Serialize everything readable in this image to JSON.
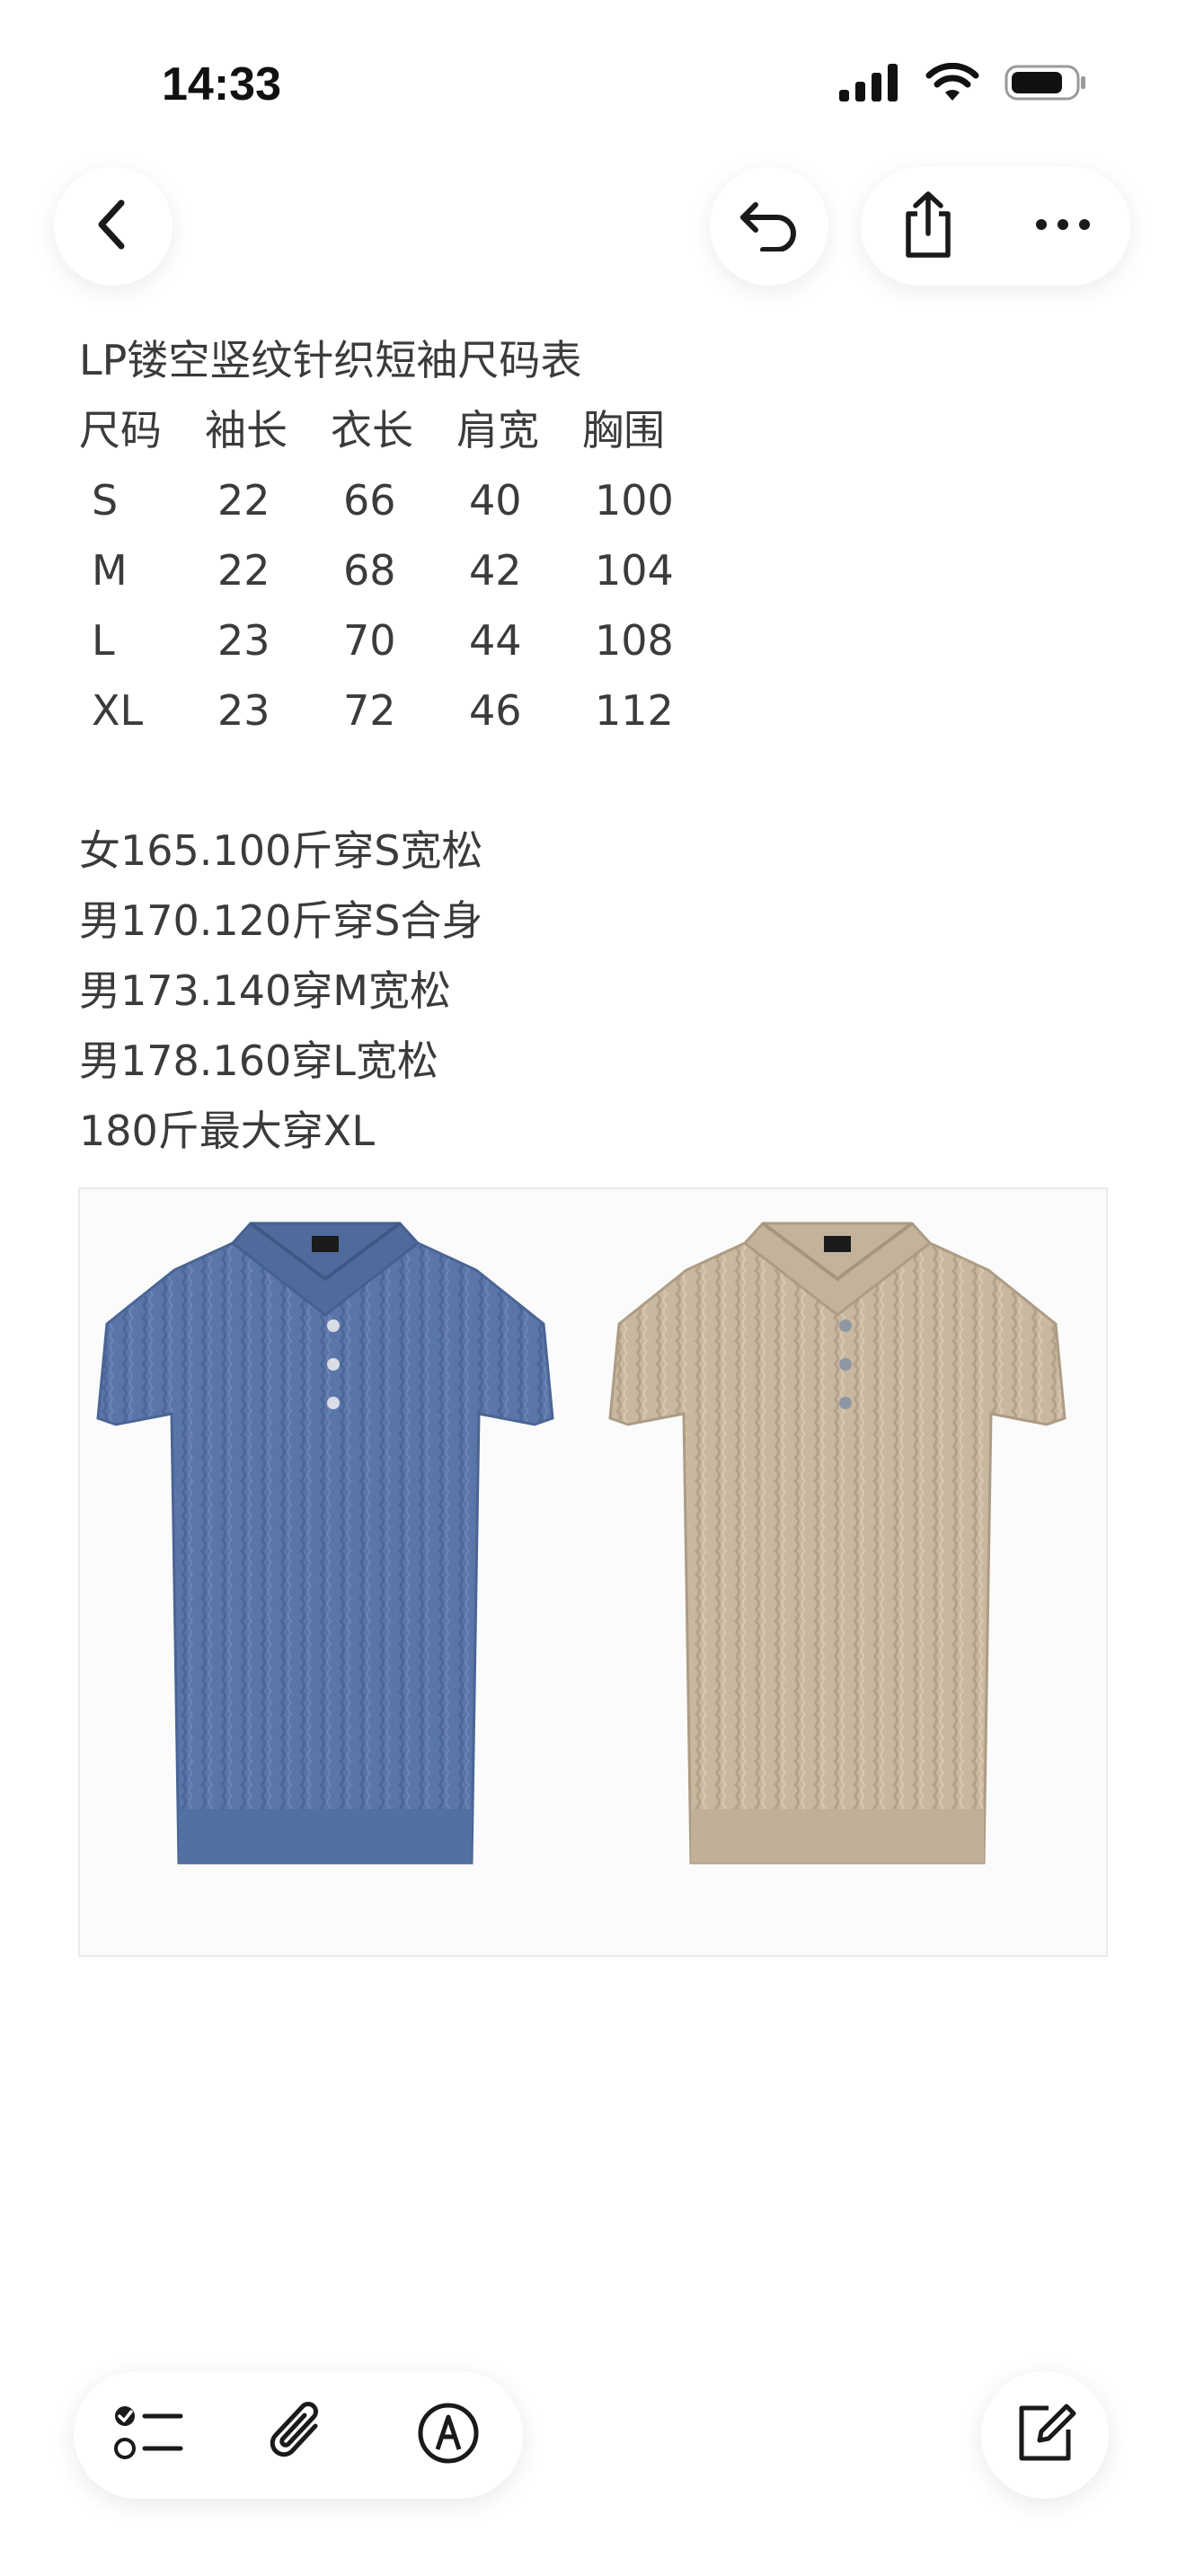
{
  "status_bar": {
    "time": "14:33"
  },
  "icons": {
    "back": "chevron-left-icon",
    "undo": "undo-icon",
    "share": "share-icon",
    "more": "more-icon",
    "checklist": "checklist-icon",
    "attach": "paperclip-icon",
    "markup": "markup-pen-icon",
    "compose": "compose-icon"
  },
  "note": {
    "title": "LP镂空竖纹针织短袖尺码表",
    "size_table": {
      "headers": [
        "尺码",
        "袖长",
        "衣长",
        "肩宽",
        "胸围"
      ],
      "rows": [
        [
          "S",
          "22",
          "66",
          "40",
          "100"
        ],
        [
          "M",
          "22",
          "68",
          "42",
          "104"
        ],
        [
          "L",
          "23",
          "70",
          "44",
          "108"
        ],
        [
          "XL",
          "23",
          "72",
          "46",
          "112"
        ]
      ]
    },
    "recommendations": [
      "女165.100斤穿S宽松",
      "男170.120斤穿S合身",
      "男173.140穿M宽松",
      "男178.160穿L宽松",
      "180斤最大穿XL"
    ]
  },
  "colors": {
    "shirt_blue": "#5a76a8",
    "shirt_beige": "#c9b8a0",
    "text": "#3b3b3b"
  }
}
